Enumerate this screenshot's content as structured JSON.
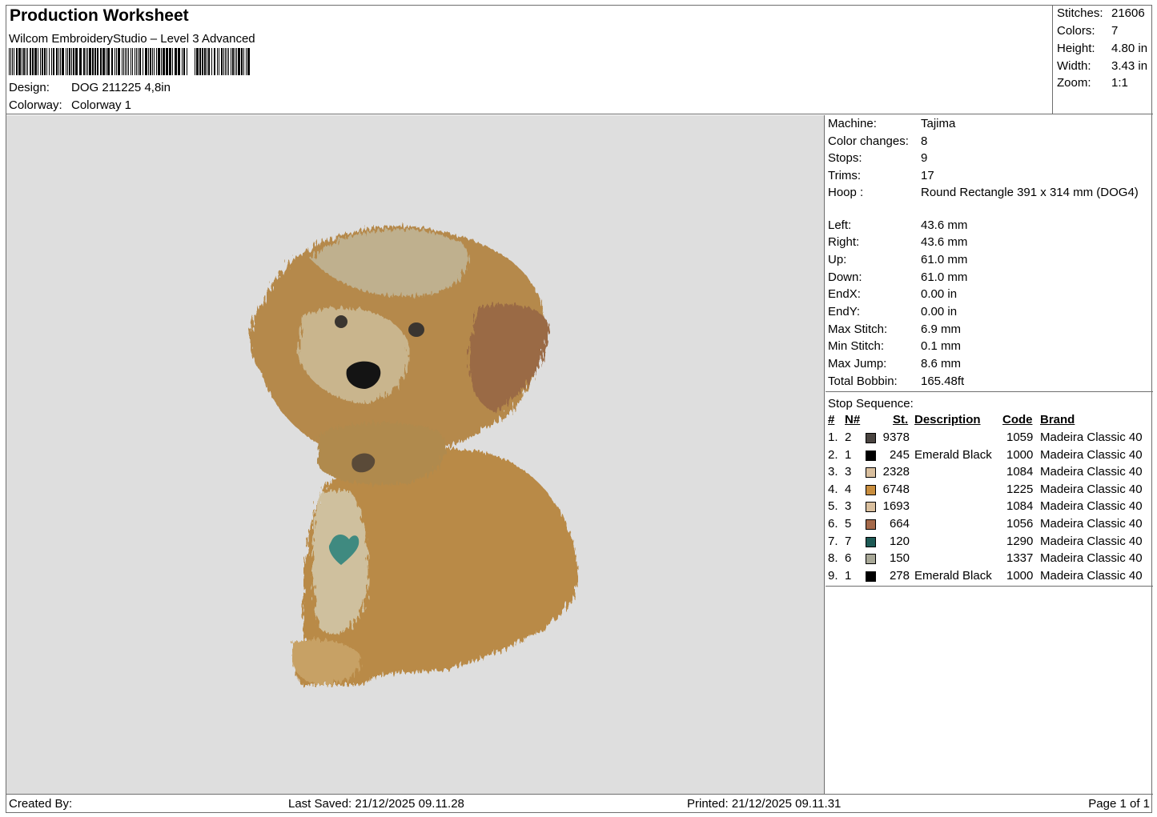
{
  "header": {
    "title": "Production Worksheet",
    "software": "Wilcom EmbroideryStudio – Level 3 Advanced",
    "design_label": "Design:",
    "design_value": "DOG 211225 4,8in",
    "colorway_label": "Colorway:",
    "colorway_value": "Colorway 1"
  },
  "stats": [
    {
      "label": "Stitches:",
      "value": "21606"
    },
    {
      "label": "Colors:",
      "value": "7"
    },
    {
      "label": "Height:",
      "value": "4.80 in"
    },
    {
      "label": "Width:",
      "value": "3.43 in"
    },
    {
      "label": "Zoom:",
      "value": "1:1"
    }
  ],
  "machine_info": [
    {
      "label": "Machine:",
      "value": "Tajima"
    },
    {
      "label": "Color changes:",
      "value": "8"
    },
    {
      "label": "Stops:",
      "value": "9"
    },
    {
      "label": "Trims:",
      "value": "17"
    },
    {
      "label": "Hoop :",
      "value": "Round Rectangle 391 x 314 mm (DOG4)"
    },
    {
      "label": "Left:",
      "value": "43.6 mm"
    },
    {
      "label": "Right:",
      "value": "43.6 mm"
    },
    {
      "label": "Up:",
      "value": "61.0 mm"
    },
    {
      "label": "Down:",
      "value": "61.0 mm"
    },
    {
      "label": "EndX:",
      "value": "0.00 in"
    },
    {
      "label": "EndY:",
      "value": "0.00 in"
    },
    {
      "label": "Max Stitch:",
      "value": "6.9 mm"
    },
    {
      "label": "Min Stitch:",
      "value": "0.1 mm"
    },
    {
      "label": "Max Jump:",
      "value": "8.6 mm"
    },
    {
      "label": "Total Bobbin:",
      "value": "165.48ft"
    }
  ],
  "stop_sequence": {
    "title": "Stop Sequence:",
    "headers": {
      "seq": "#",
      "needle": "N#",
      "stitches": "St.",
      "description": "Description",
      "code": "Code",
      "brand": "Brand"
    },
    "rows": [
      {
        "seq": "1.",
        "needle": "2",
        "color": "#4a4440",
        "stitches": "9378",
        "description": "",
        "code": "1059",
        "brand": "Madeira Classic 40"
      },
      {
        "seq": "2.",
        "needle": "1",
        "color": "#000000",
        "stitches": "245",
        "description": "Emerald Black",
        "code": "1000",
        "brand": "Madeira Classic 40"
      },
      {
        "seq": "3.",
        "needle": "3",
        "color": "#d9bf9e",
        "stitches": "2328",
        "description": "",
        "code": "1084",
        "brand": "Madeira Classic 40"
      },
      {
        "seq": "4.",
        "needle": "4",
        "color": "#c98e3e",
        "stitches": "6748",
        "description": "",
        "code": "1225",
        "brand": "Madeira Classic 40"
      },
      {
        "seq": "5.",
        "needle": "3",
        "color": "#d9bf9e",
        "stitches": "1693",
        "description": "",
        "code": "1084",
        "brand": "Madeira Classic 40"
      },
      {
        "seq": "6.",
        "needle": "5",
        "color": "#a5694a",
        "stitches": "664",
        "description": "",
        "code": "1056",
        "brand": "Madeira Classic 40"
      },
      {
        "seq": "7.",
        "needle": "7",
        "color": "#1d5a55",
        "stitches": "120",
        "description": "",
        "code": "1290",
        "brand": "Madeira Classic 40"
      },
      {
        "seq": "8.",
        "needle": "6",
        "color": "#a8a897",
        "stitches": "150",
        "description": "",
        "code": "1337",
        "brand": "Madeira Classic 40"
      },
      {
        "seq": "9.",
        "needle": "1",
        "color": "#000000",
        "stitches": "278",
        "description": "Emerald Black",
        "code": "1000",
        "brand": "Madeira Classic 40"
      }
    ]
  },
  "footer": {
    "created_by": "Created By:",
    "last_saved": "Last Saved: 21/12/2025 09.11.28",
    "printed": "Printed: 21/12/2025 09.11.31",
    "page": "Page 1 of 1"
  },
  "colors": {
    "canvas": "#dedede",
    "border": "#6e6e6e"
  }
}
